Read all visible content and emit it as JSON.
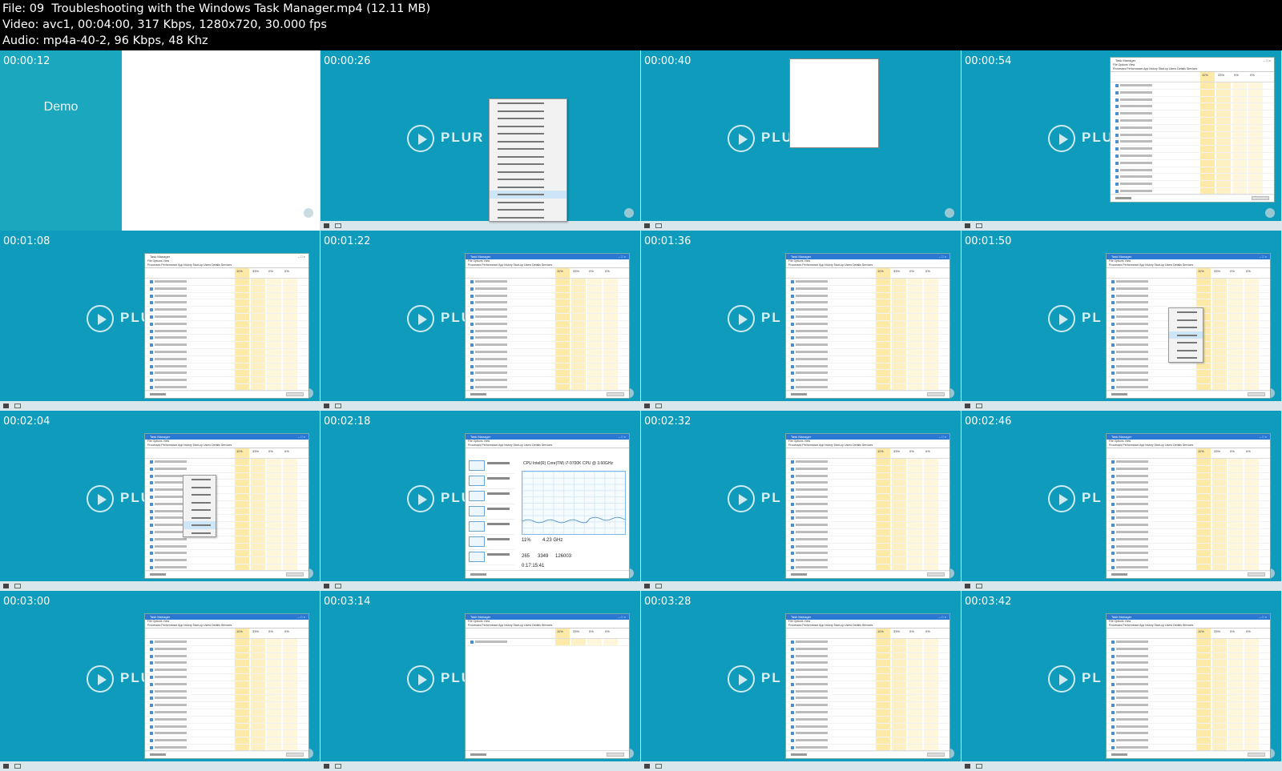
{
  "header": {
    "file_line": "File: 09  Troubleshooting with the Windows Task Manager.mp4 (12.11 MB)",
    "video_line": "Video: avc1, 00:04:00, 317 Kbps, 1280x720, 30.000 fps",
    "audio_line": "Audio: mp4a-40-2, 96 Kbps, 48 Khz"
  },
  "brand": {
    "logo_text": "PLUR",
    "short_text": "PL"
  },
  "demo_label": "Demo",
  "thumbnails": [
    {
      "timestamp": "00:00:12",
      "kind": "demo"
    },
    {
      "timestamp": "00:00:26",
      "kind": "context-menu"
    },
    {
      "timestamp": "00:00:40",
      "kind": "small-window"
    },
    {
      "timestamp": "00:00:54",
      "kind": "task-manager"
    },
    {
      "timestamp": "00:01:08",
      "kind": "task-manager"
    },
    {
      "timestamp": "00:01:22",
      "kind": "task-manager"
    },
    {
      "timestamp": "00:01:36",
      "kind": "task-manager"
    },
    {
      "timestamp": "00:01:50",
      "kind": "task-manager-menu"
    },
    {
      "timestamp": "00:02:04",
      "kind": "task-manager-menu"
    },
    {
      "timestamp": "00:02:18",
      "kind": "performance"
    },
    {
      "timestamp": "00:02:32",
      "kind": "task-manager"
    },
    {
      "timestamp": "00:02:46",
      "kind": "task-manager"
    },
    {
      "timestamp": "00:03:00",
      "kind": "task-manager"
    },
    {
      "timestamp": "00:03:14",
      "kind": "task-manager-empty"
    },
    {
      "timestamp": "00:03:28",
      "kind": "task-manager"
    },
    {
      "timestamp": "00:03:42",
      "kind": "task-manager"
    }
  ],
  "task_manager": {
    "title": "Task Manager",
    "menu": "File  Options  View",
    "tabs": "Processes  Performance  App history  Start-up  Users  Details  Services",
    "cpu_pct": "11%",
    "mem_pct": "33%",
    "disk_pct": "0%",
    "net_pct": "0%",
    "fewer_details": "Fewer details"
  },
  "performance": {
    "heading": "CPU",
    "cpu_model": "Intel(R) Core(TM) i7-9700K CPU @ 3.60GHz",
    "utilization": "11%",
    "speed": "4.23 GHz",
    "processes": "265",
    "threads": "3349",
    "handles": "126003",
    "uptime": "0:17:15:41"
  }
}
